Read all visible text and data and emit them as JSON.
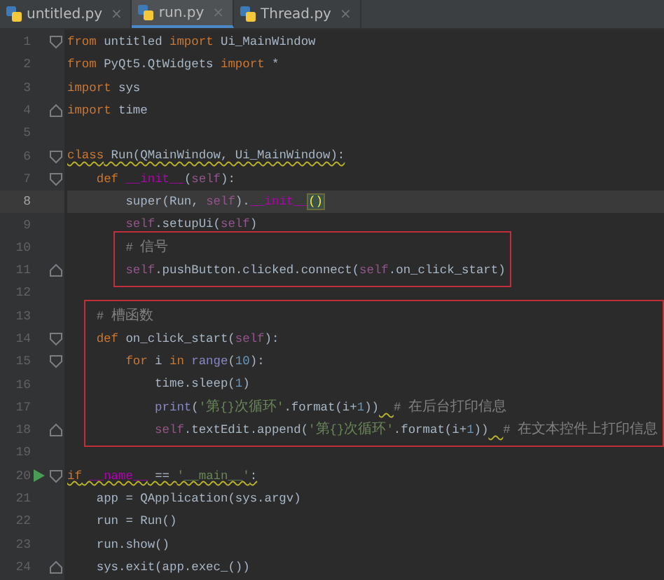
{
  "tabs": [
    {
      "label": "untitled.py",
      "close": "×",
      "selected": false
    },
    {
      "label": "run.py",
      "close": "×",
      "selected": true
    },
    {
      "label": "Thread.py",
      "close": "×",
      "selected": false
    }
  ],
  "editor": {
    "blocks": [
      {
        "kind": "plain",
        "lines": [
          {
            "number": "1",
            "fold_open": true,
            "fold_close": false,
            "current": false,
            "run": false,
            "warning": false,
            "tokens": [
              {
                "kind": "keyword",
                "text": "from"
              },
              {
                "kind": "plain",
                "text": " untitled "
              },
              {
                "kind": "keyword",
                "text": "import"
              },
              {
                "kind": "plain",
                "text": " Ui_MainWindow"
              }
            ]
          },
          {
            "number": "2",
            "fold_open": false,
            "fold_close": false,
            "current": false,
            "run": false,
            "warning": false,
            "tokens": [
              {
                "kind": "keyword",
                "text": "from"
              },
              {
                "kind": "plain",
                "text": " PyQt5.QtWidgets "
              },
              {
                "kind": "keyword",
                "text": "import"
              },
              {
                "kind": "plain",
                "text": " *"
              }
            ]
          },
          {
            "number": "3",
            "fold_open": false,
            "fold_close": false,
            "current": false,
            "run": false,
            "warning": false,
            "tokens": [
              {
                "kind": "keyword",
                "text": "import"
              },
              {
                "kind": "plain",
                "text": " sys"
              }
            ]
          },
          {
            "number": "4",
            "fold_open": false,
            "fold_close": true,
            "current": false,
            "run": false,
            "warning": false,
            "tokens": [
              {
                "kind": "keyword",
                "text": "import"
              },
              {
                "kind": "plain",
                "text": " time"
              }
            ]
          },
          {
            "number": "5",
            "fold_open": false,
            "fold_close": false,
            "current": false,
            "run": false
          },
          {
            "number": "6",
            "fold_open": true,
            "fold_close": false,
            "current": false,
            "run": false,
            "warning": true,
            "tokens": [
              {
                "kind": "keyword",
                "text": "class"
              },
              {
                "kind": "plain",
                "text": " Run(QMainWindow, Ui_MainWindow):"
              }
            ]
          },
          {
            "number": "7",
            "fold_open": true,
            "fold_close": false,
            "current": false,
            "run": false,
            "warning": false,
            "tokens": [
              {
                "kind": "keyword",
                "text": "    def "
              },
              {
                "kind": "dunder",
                "text": "__init__"
              },
              {
                "kind": "plain",
                "text": "("
              },
              {
                "kind": "self",
                "text": "self"
              },
              {
                "kind": "plain",
                "text": "):"
              }
            ]
          },
          {
            "number": "8",
            "fold_open": false,
            "fold_close": false,
            "current": true,
            "run": false,
            "warning": false,
            "tokens": [
              {
                "kind": "plain",
                "text": "        super(Run, "
              },
              {
                "kind": "self",
                "text": "self"
              },
              {
                "kind": "plain",
                "text": ")."
              },
              {
                "kind": "dunder",
                "text": "__init__"
              },
              {
                "kind": "brace",
                "text": "()"
              }
            ]
          },
          {
            "number": "9",
            "fold_open": false,
            "fold_close": false,
            "current": false,
            "run": false,
            "warning": false,
            "tokens": [
              {
                "kind": "self",
                "text": "        self"
              },
              {
                "kind": "plain",
                "text": ".setupUi("
              },
              {
                "kind": "self",
                "text": "self"
              },
              {
                "kind": "plain",
                "text": ")"
              }
            ]
          }
        ]
      },
      {
        "kind": "highlight-box",
        "lines": [
          {
            "number": "10",
            "fold_open": false,
            "fold_close": false,
            "current": false,
            "run": false,
            "warning": false,
            "tokens": [
              {
                "kind": "comment",
                "text": "        # 信号"
              }
            ]
          },
          {
            "number": "11",
            "fold_open": false,
            "fold_close": true,
            "current": false,
            "run": false,
            "warning": false,
            "tokens": [
              {
                "kind": "self",
                "text": "        self"
              },
              {
                "kind": "plain",
                "text": ".pushButton.clicked.connect("
              },
              {
                "kind": "self",
                "text": "self"
              },
              {
                "kind": "plain",
                "text": ".on_click_start)"
              }
            ]
          }
        ]
      },
      {
        "kind": "plain",
        "lines": [
          {
            "number": "12",
            "fold_open": false,
            "fold_close": false,
            "current": false,
            "run": false
          }
        ]
      },
      {
        "kind": "highlight-box",
        "lines": [
          {
            "number": "13",
            "fold_open": false,
            "fold_close": false,
            "current": false,
            "run": false,
            "warning": false,
            "tokens": [
              {
                "kind": "comment",
                "text": "    # 槽函数"
              }
            ]
          },
          {
            "number": "14",
            "fold_open": true,
            "fold_close": false,
            "current": false,
            "run": false,
            "warning": false,
            "tokens": [
              {
                "kind": "keyword",
                "text": "    def"
              },
              {
                "kind": "plain",
                "text": " on_click_start("
              },
              {
                "kind": "self",
                "text": "self"
              },
              {
                "kind": "plain",
                "text": "):"
              }
            ]
          },
          {
            "number": "15",
            "fold_open": true,
            "fold_close": false,
            "current": false,
            "run": false,
            "warning": false,
            "tokens": [
              {
                "kind": "keyword",
                "text": "        for"
              },
              {
                "kind": "plain",
                "text": " i "
              },
              {
                "kind": "keyword",
                "text": "in "
              },
              {
                "kind": "builtin",
                "text": "range"
              },
              {
                "kind": "plain",
                "text": "("
              },
              {
                "kind": "number",
                "text": "10"
              },
              {
                "kind": "plain",
                "text": "):"
              }
            ]
          },
          {
            "number": "16",
            "fold_open": false,
            "fold_close": false,
            "current": false,
            "run": false,
            "warning": false,
            "tokens": [
              {
                "kind": "plain",
                "text": "            time.sleep("
              },
              {
                "kind": "number",
                "text": "1"
              },
              {
                "kind": "plain",
                "text": ")"
              }
            ]
          },
          {
            "number": "17",
            "fold_open": false,
            "fold_close": false,
            "current": false,
            "run": false,
            "warning": false,
            "tokens": [
              {
                "kind": "builtin",
                "text": "            print"
              },
              {
                "kind": "plain",
                "text": "("
              },
              {
                "kind": "string",
                "text": "'第{}次循环'"
              },
              {
                "kind": "plain",
                "text": ".format(i+"
              },
              {
                "kind": "number",
                "text": "1"
              },
              {
                "kind": "plain",
                "text": "))"
              },
              {
                "kind": "comment-after-warning",
                "text": "  # 在后台打印信息"
              }
            ]
          },
          {
            "number": "18",
            "fold_open": false,
            "fold_close": true,
            "current": false,
            "run": false,
            "warning": false,
            "tokens": [
              {
                "kind": "self",
                "text": "            self"
              },
              {
                "kind": "plain",
                "text": ".textEdit.append("
              },
              {
                "kind": "string",
                "text": "'第{}次循环'"
              },
              {
                "kind": "plain",
                "text": ".format(i+"
              },
              {
                "kind": "number",
                "text": "1"
              },
              {
                "kind": "plain",
                "text": "))"
              },
              {
                "kind": "comment-after-warning",
                "text": "  # 在文本控件上打印信息"
              }
            ]
          }
        ]
      },
      {
        "kind": "plain",
        "lines": [
          {
            "number": "19",
            "fold_open": false,
            "fold_close": false,
            "current": false,
            "run": false
          },
          {
            "number": "20",
            "fold_open": true,
            "fold_close": false,
            "current": false,
            "run": true,
            "warning": true,
            "tokens": [
              {
                "kind": "keyword",
                "text": "if"
              },
              {
                "kind": "dunder",
                "text": " __name__"
              },
              {
                "kind": "plain",
                "text": " == "
              },
              {
                "kind": "string",
                "text": "'__main__'"
              },
              {
                "kind": "plain",
                "text": ":"
              }
            ]
          },
          {
            "number": "21",
            "fold_open": false,
            "fold_close": false,
            "current": false,
            "run": false,
            "warning": false,
            "tokens": [
              {
                "kind": "plain",
                "text": "    app = QApplication(sys.argv)"
              }
            ]
          },
          {
            "number": "22",
            "fold_open": false,
            "fold_close": false,
            "current": false,
            "run": false,
            "warning": false,
            "tokens": [
              {
                "kind": "plain",
                "text": "    run = Run()"
              }
            ]
          },
          {
            "number": "23",
            "fold_open": false,
            "fold_close": false,
            "current": false,
            "run": false,
            "warning": false,
            "tokens": [
              {
                "kind": "plain",
                "text": "    run.show()"
              }
            ]
          },
          {
            "number": "24",
            "fold_open": false,
            "fold_close": true,
            "current": false,
            "run": false,
            "warning": false,
            "tokens": [
              {
                "kind": "plain",
                "text": "    sys.exit(app.exec_())"
              }
            ]
          }
        ]
      }
    ]
  }
}
